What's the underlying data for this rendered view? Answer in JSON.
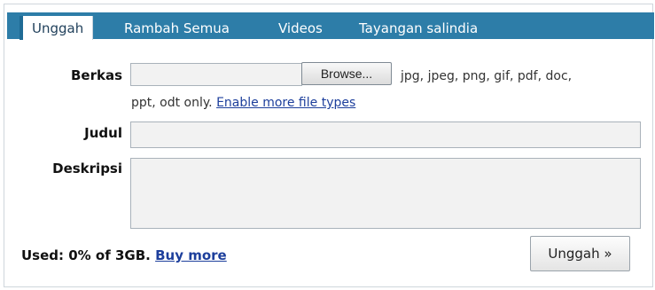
{
  "tabs": {
    "upload": "Unggah",
    "browse_all": "Rambah Semua",
    "videos": "Videos",
    "slideshows": "Tayangan salindia"
  },
  "form": {
    "file_label": "Berkas",
    "browse_label": "Browse...",
    "types_line1": "jpg, jpeg, png, gif, pdf, doc,",
    "types_line2": "ppt, odt only.",
    "enable_more": "Enable more file types",
    "title_label": "Judul",
    "description_label": "Deskripsi",
    "title_value": "",
    "description_value": "",
    "file_value": ""
  },
  "footer": {
    "used_text": "Used: 0% of 3GB.",
    "buy_more": "Buy more",
    "submit_label": "Unggah »"
  },
  "colors": {
    "tabbar": "#2d7da8",
    "link": "#1d3f9c"
  }
}
